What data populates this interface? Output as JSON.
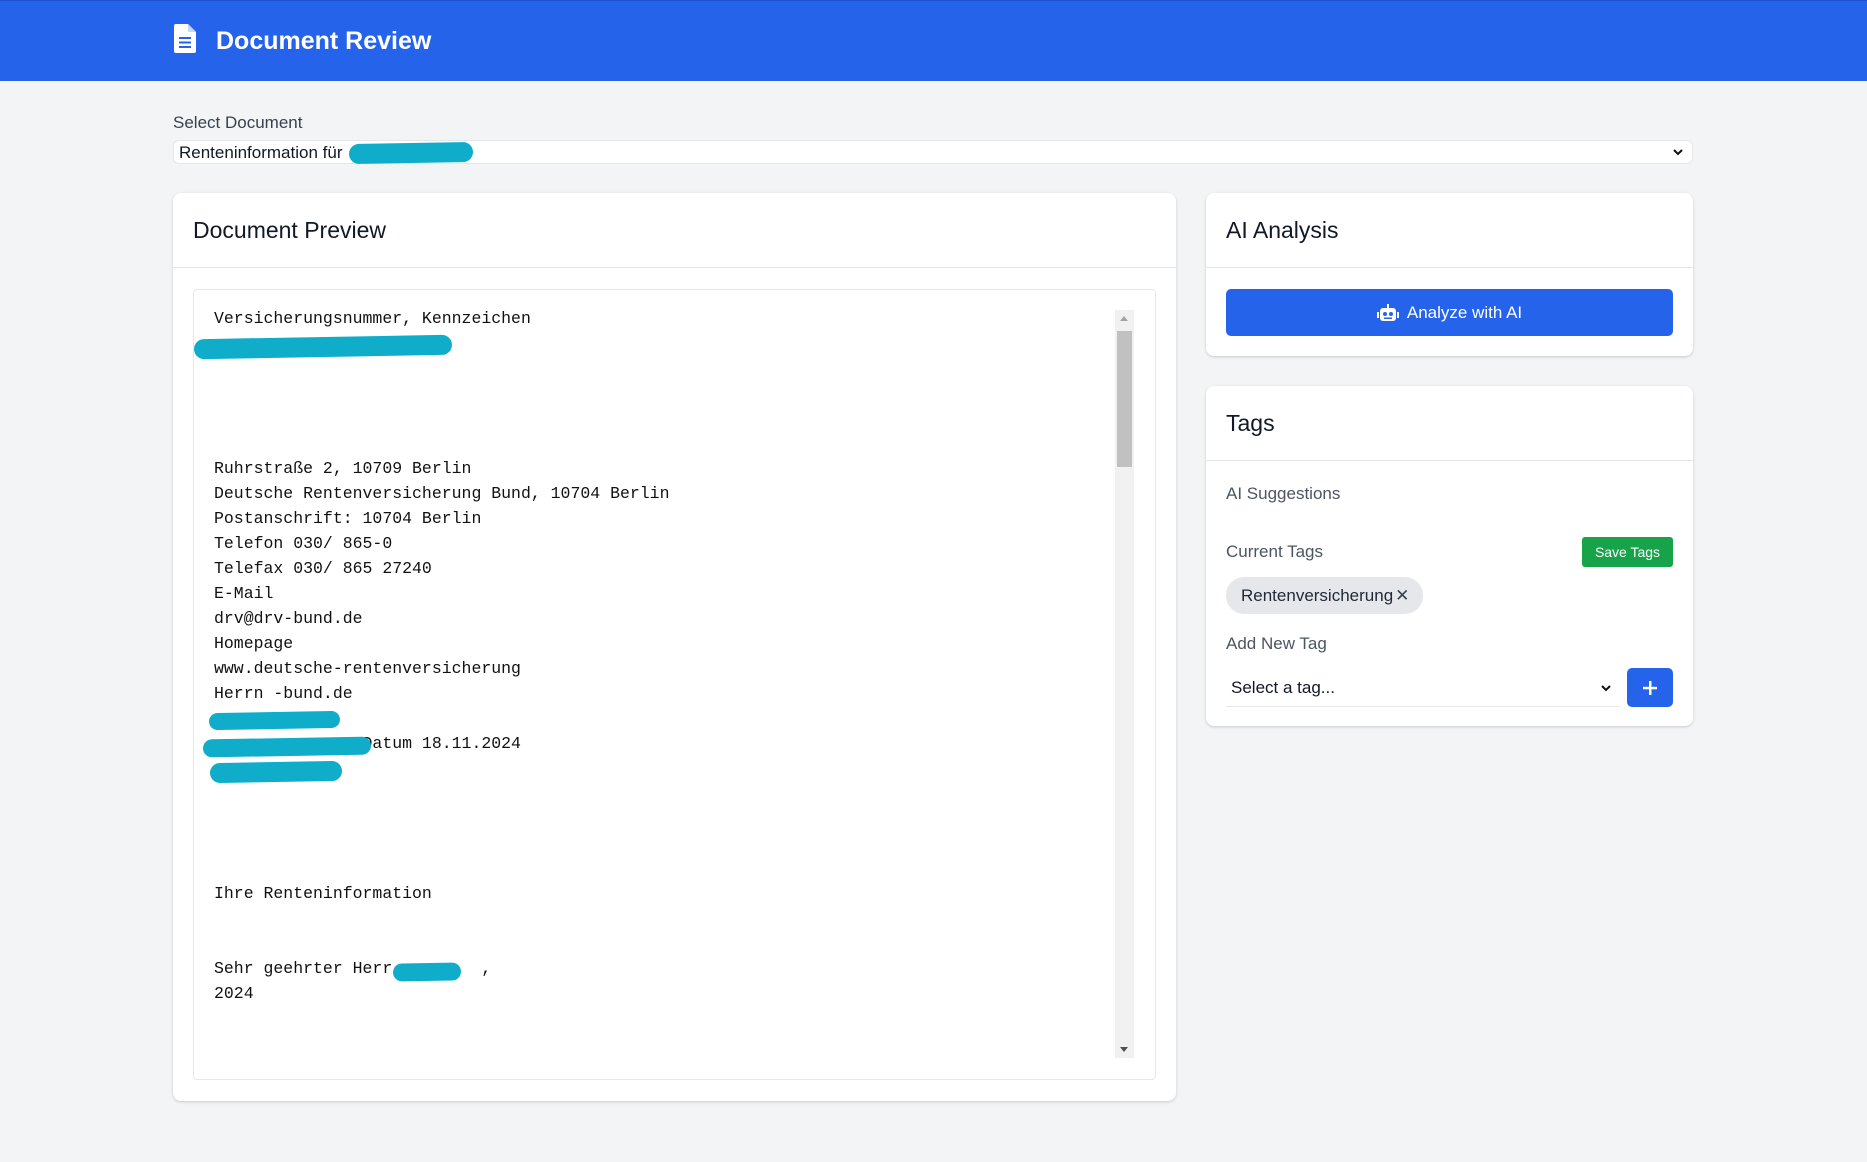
{
  "header": {
    "title": "Document Review",
    "icon": "document-icon",
    "color": "#2563eb"
  },
  "document_select": {
    "label": "Select Document",
    "value": "Renteninformation für"
  },
  "preview": {
    "title": "Document Preview",
    "text": "Versicherungsnummer, Kennzeichen\n\n\n\n\n\nRuhrstraße 2, 10709 Berlin\nDeutsche Rentenversicherung Bund, 10704 Berlin\nPostanschrift: 10704 Berlin\nTelefon 030/ 865-0\nTelefax 030/ 865 27240\nE-Mail\ndrv@drv-bund.de\nHomepage\nwww.deutsche-rentenversicherung\nHerrn -bund.de\n\n               Datum 18.11.2024\n\n\n\n\n\nIhre Renteninformation\n\n\nSehr geehrter Herr         ,\n2024"
  },
  "ai_analysis": {
    "title": "AI Analysis",
    "button_label": "Analyze with AI",
    "button_icon": "robot-icon"
  },
  "tags": {
    "title": "Tags",
    "ai_suggestions_label": "AI Suggestions",
    "current_tags_label": "Current Tags",
    "save_button_label": "Save Tags",
    "save_color": "#16a34a",
    "current_tags": [
      "Rentenversicherung"
    ],
    "remove_glyph": "✕",
    "add_label": "Add New Tag",
    "select_placeholder": "Select a tag...",
    "add_icon": "plus-icon"
  }
}
